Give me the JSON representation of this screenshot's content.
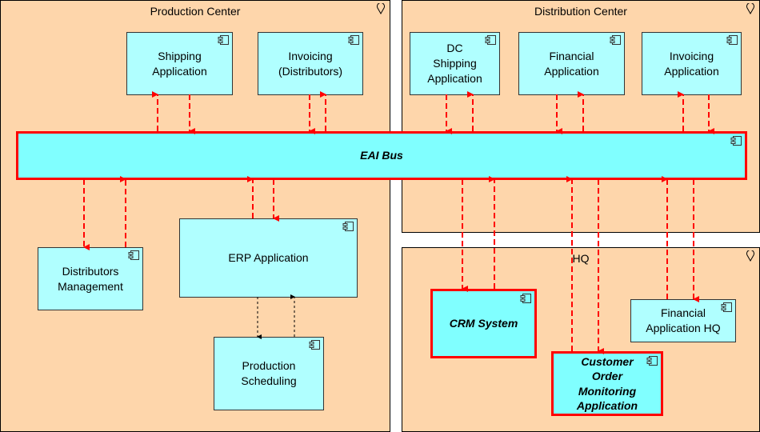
{
  "groups": {
    "production": "Production Center",
    "distribution": "Distribution Center",
    "hq": "HQ"
  },
  "components": {
    "shipping": "Shipping\nApplication",
    "invoicing_dist": "Invoicing\n(Distributors)",
    "dc_shipping": "DC\nShipping\nApplication",
    "financial": "Financial\nApplication",
    "invoicing_app": "Invoicing\nApplication",
    "eai_bus": "EAI Bus",
    "distributors_mgmt": "Distributors\nManagement",
    "erp": "ERP Application",
    "production_scheduling": "Production\nScheduling",
    "crm": "CRM System",
    "customer_order": "Customer\nOrder\nMonitoring\nApplication",
    "financial_hq": "Financial\nApplication HQ"
  },
  "colors": {
    "group_fill": "#fed6ab",
    "component_fill": "#b0ffff",
    "highlight_fill": "#80ffff",
    "highlight_border": "#ff0000",
    "flow_color": "#ff0000"
  },
  "icons": {
    "group": "location-pin-icon",
    "component": "application-component-icon"
  }
}
